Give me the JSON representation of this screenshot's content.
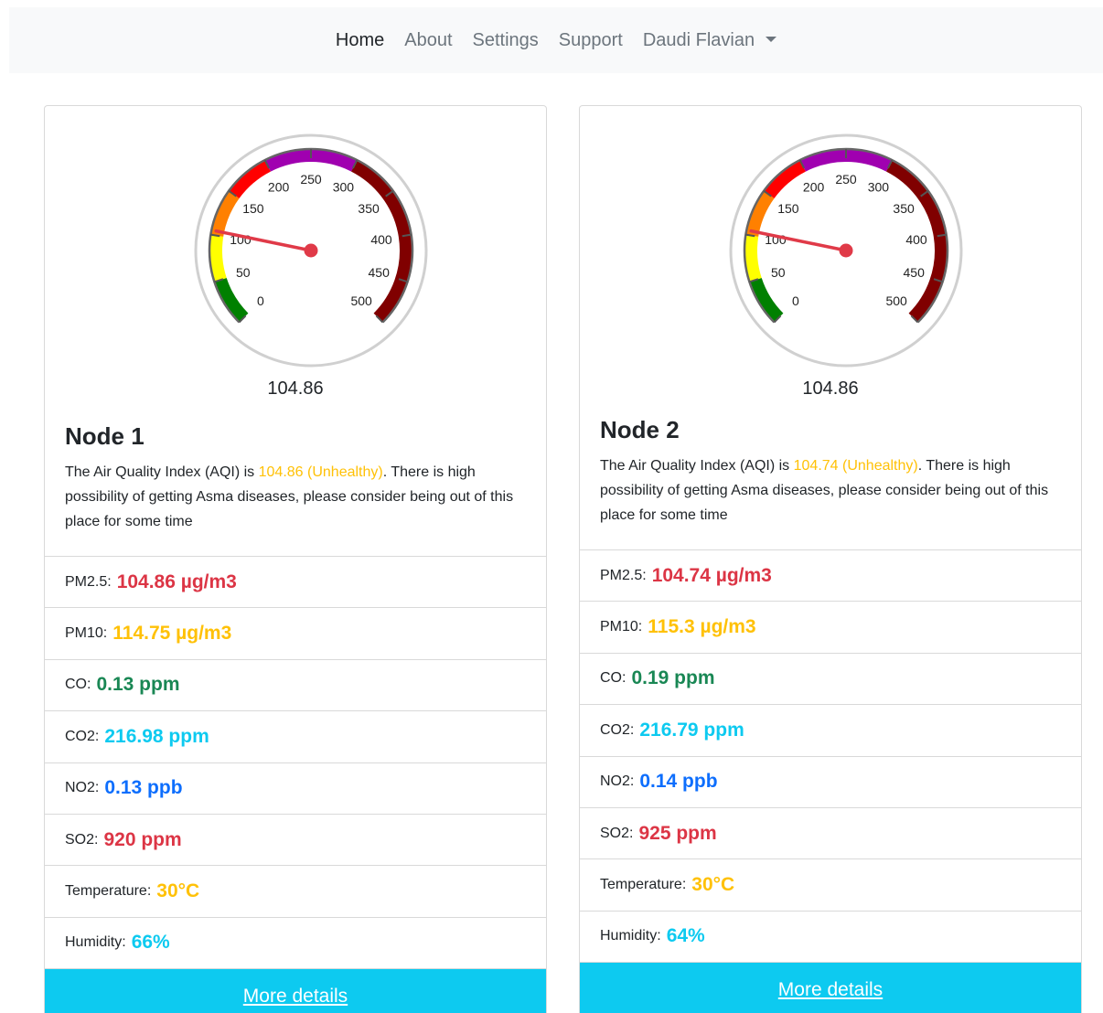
{
  "nav": {
    "items": [
      {
        "label": "Home",
        "active": true
      },
      {
        "label": "About",
        "active": false
      },
      {
        "label": "Settings",
        "active": false
      },
      {
        "label": "Support",
        "active": false
      }
    ],
    "user": "Daudi Flavian"
  },
  "gauge": {
    "ticks": [
      "0",
      "50",
      "100",
      "150",
      "200",
      "250",
      "300",
      "350",
      "400",
      "450",
      "500"
    ],
    "bands": [
      {
        "from": 0,
        "to": 50,
        "color": "#008000"
      },
      {
        "from": 50,
        "to": 100,
        "color": "#ffff00"
      },
      {
        "from": 100,
        "to": 150,
        "color": "#ff8000"
      },
      {
        "from": 150,
        "to": 200,
        "color": "#ff0000"
      },
      {
        "from": 200,
        "to": 300,
        "color": "#a000b0"
      },
      {
        "from": 300,
        "to": 500,
        "color": "#800000"
      }
    ],
    "needle_color": "#e03a48"
  },
  "nodes": [
    {
      "gauge_value": "104.86",
      "gauge_num": 104.86,
      "title": "Node 1",
      "text_before": "The Air Quality Index (AQI) is ",
      "aqi_text": "104.86 (Unhealthy)",
      "text_after": ". There is high possibility of getting Asma diseases, please consider being out of this place for some time",
      "metrics": [
        {
          "label": "PM2.5:",
          "value": "104.86 µg/m3",
          "color": "danger"
        },
        {
          "label": "PM10:",
          "value": "114.75 µg/m3",
          "color": "warning"
        },
        {
          "label": "CO:",
          "value": "0.13 ppm",
          "color": "success"
        },
        {
          "label": "CO2:",
          "value": "216.98 ppm",
          "color": "info"
        },
        {
          "label": "NO2:",
          "value": "0.13 ppb",
          "color": "primary"
        },
        {
          "label": "SO2:",
          "value": "920 ppm",
          "color": "danger"
        },
        {
          "label": "Temperature:",
          "value": "30°C",
          "color": "warning"
        },
        {
          "label": "Humidity:",
          "value": "66%",
          "color": "info"
        }
      ],
      "button": "More details"
    },
    {
      "gauge_value": "104.86",
      "gauge_num": 104.86,
      "title": "Node 2",
      "text_before": "The Air Quality Index (AQI) is ",
      "aqi_text": "104.74 (Unhealthy)",
      "text_after": ". There is high possibility of getting Asma diseases, please consider being out of this place for some time",
      "metrics": [
        {
          "label": "PM2.5:",
          "value": "104.74 µg/m3",
          "color": "danger"
        },
        {
          "label": "PM10:",
          "value": "115.3 µg/m3",
          "color": "warning"
        },
        {
          "label": "CO:",
          "value": "0.19 ppm",
          "color": "success"
        },
        {
          "label": "CO2:",
          "value": "216.79 ppm",
          "color": "info"
        },
        {
          "label": "NO2:",
          "value": "0.14 ppb",
          "color": "primary"
        },
        {
          "label": "SO2:",
          "value": "925 ppm",
          "color": "danger"
        },
        {
          "label": "Temperature:",
          "value": "30°C",
          "color": "warning"
        },
        {
          "label": "Humidity:",
          "value": "64%",
          "color": "info"
        }
      ],
      "button": "More details"
    }
  ]
}
